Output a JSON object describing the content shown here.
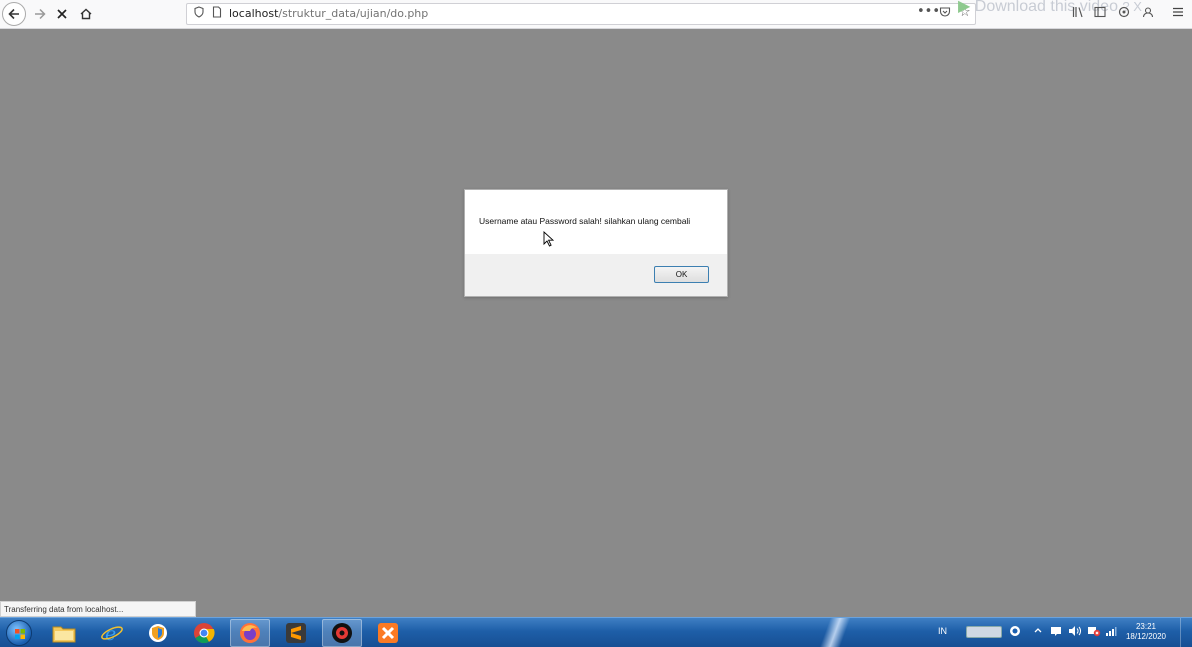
{
  "browser": {
    "url_host": "localhost",
    "url_path": "/struktur_data/ujian/do.php",
    "overlay_text": "Download this video",
    "overlay_extra": "? X"
  },
  "dialog": {
    "message": "Username atau Password salah! silahkan ulang cembali",
    "ok_label": "OK"
  },
  "status": {
    "text": "Transferring data from localhost..."
  },
  "taskbar": {
    "language": "IN",
    "time": "23:21",
    "date": "18/12/2020"
  }
}
